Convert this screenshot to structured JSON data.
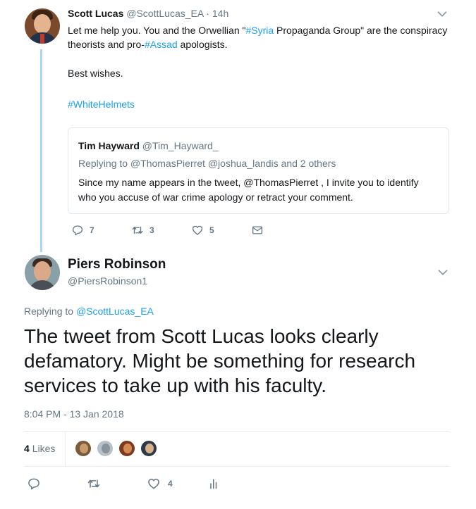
{
  "reply_tweet": {
    "author_name": "Scott Lucas",
    "author_handle": "@ScottLucas_EA",
    "separator": "·",
    "time": "14h",
    "text_parts": {
      "p1": "Let me help you. You and the Orwellian \"",
      "tag_syria": "#Syria",
      "p2": " Propaganda Group\" are the conspiracy theorists and pro-",
      "tag_assad": "#Assad",
      "p3": " apologists."
    },
    "signoff": "Best wishes.",
    "hashtag": "#WhiteHelmets",
    "quoted": {
      "author_name": "Tim Hayward",
      "author_handle": "@Tim_Hayward_",
      "replying_to": "Replying to @ThomasPierret @joshua_landis and 2 others",
      "text": "Since my name appears in the tweet, @ThomasPierret , I invite you to identify who you accuse of war crime apology or retract your comment."
    },
    "actions": {
      "replies": "7",
      "retweets": "3",
      "likes": "5"
    },
    "icons": [
      "reply-icon",
      "retweet-icon",
      "like-icon",
      "dm-icon",
      "chevron-down-icon"
    ]
  },
  "main_tweet": {
    "author_name": "Piers Robinson",
    "author_handle": "@PiersRobinson1",
    "replying_prefix": "Replying to ",
    "replying_handle": "@ScottLucas_EA",
    "text": "The tweet from Scott Lucas looks clearly defamatory. Might be something for research services to take up with his faculty.",
    "timestamp": "8:04 PM - 13 Jan 2018",
    "likes_count": "4",
    "likes_word": "Likes",
    "actions": {
      "likes": "4"
    },
    "icons": [
      "reply-icon",
      "retweet-icon",
      "like-icon",
      "analytics-icon",
      "chevron-down-icon"
    ]
  },
  "colors": {
    "link": "#1da1f2",
    "muted": "#657786",
    "thread_line": "#a9d6f5",
    "divider": "#e6ecf0"
  }
}
